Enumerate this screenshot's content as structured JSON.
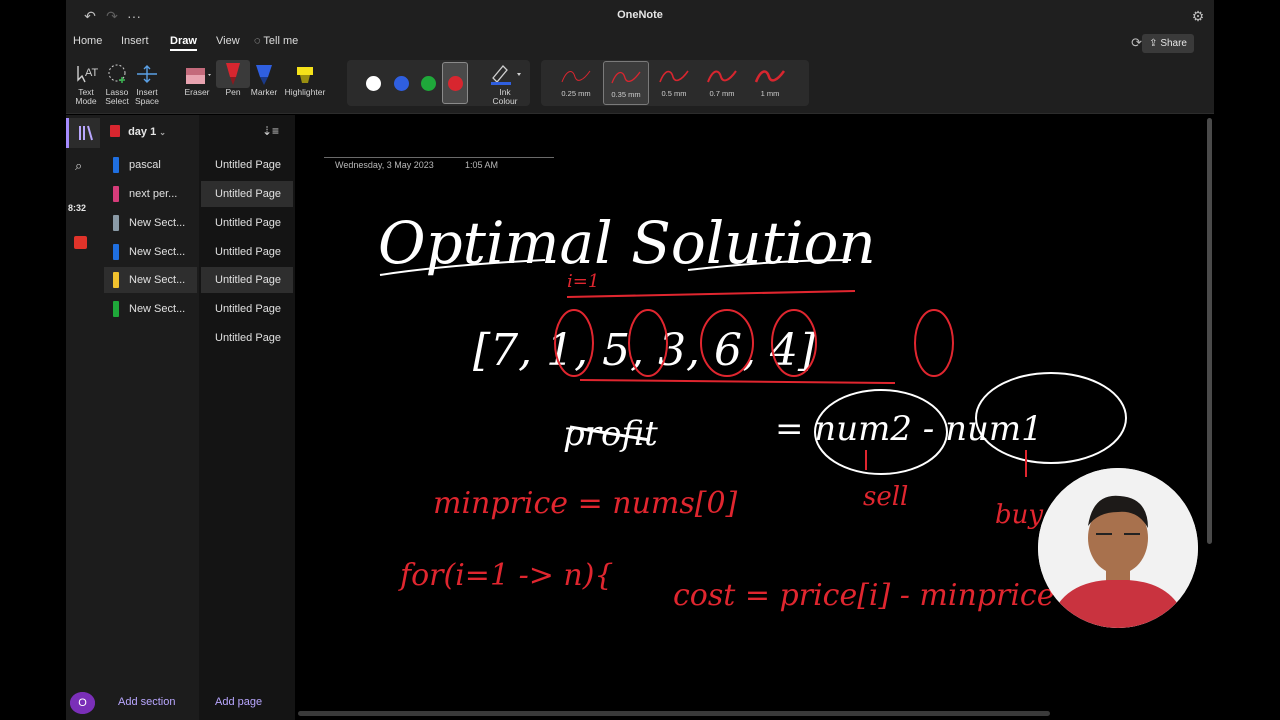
{
  "app": {
    "title": "OneNote"
  },
  "titlebar": {
    "more": "···"
  },
  "tabs": [
    "Home",
    "Insert",
    "Draw",
    "View",
    "Tell me"
  ],
  "toolbar": {
    "share": "Share"
  },
  "ribbon": {
    "text_mode": [
      "Text",
      "Mode"
    ],
    "lasso": [
      "Lasso",
      "Select"
    ],
    "insert_space": [
      "Insert",
      "Space"
    ],
    "eraser": "Eraser",
    "pen": "Pen",
    "marker": "Marker",
    "highlighter": "Highlighter",
    "ink_colour": [
      "Ink",
      "Colour"
    ],
    "colors": [
      "#ffffff",
      "#2f5fe0",
      "#1fa83a",
      "#d8262f"
    ],
    "sizes": [
      "0.25 mm",
      "0.35 mm",
      "0.5 mm",
      "0.7 mm",
      "1 mm"
    ],
    "selected_size": "0.35 mm"
  },
  "rail": {
    "time": "8:32",
    "avatar": "O"
  },
  "notebook": {
    "name": "day 1"
  },
  "sections": [
    {
      "label": "pascal",
      "color": "#1f6fe0"
    },
    {
      "label": "next per...",
      "color": "#d63c7a"
    },
    {
      "label": "New Sect...",
      "color": "#8a9aa6"
    },
    {
      "label": "New Sect...",
      "color": "#1f6fe0"
    },
    {
      "label": "New Sect...",
      "color": "#f2c22e"
    },
    {
      "label": "New Sect...",
      "color": "#1fa83a"
    }
  ],
  "pages": [
    "Untitled Page",
    "Untitled Page",
    "Untitled Page",
    "Untitled Page",
    "Untitled Page",
    "Untitled Page",
    "Untitled Page"
  ],
  "footer": {
    "add_section": "Add section",
    "add_page": "Add page"
  },
  "note": {
    "date": "Wednesday, 3 May 2023",
    "time": "1:05 AM"
  },
  "ink": {
    "heading": "Optimal Solution",
    "array": "[7, 1, 5, 3, 6, 4]",
    "index_label": "i=1",
    "formula_left": "profit",
    "formula_right": "= num2 - num1",
    "sell": "sell",
    "buy": "buy",
    "line1": "minprice = nums[0]",
    "line2": "for(i=1 -> n){",
    "line3": "cost = price[i] - minprice"
  }
}
